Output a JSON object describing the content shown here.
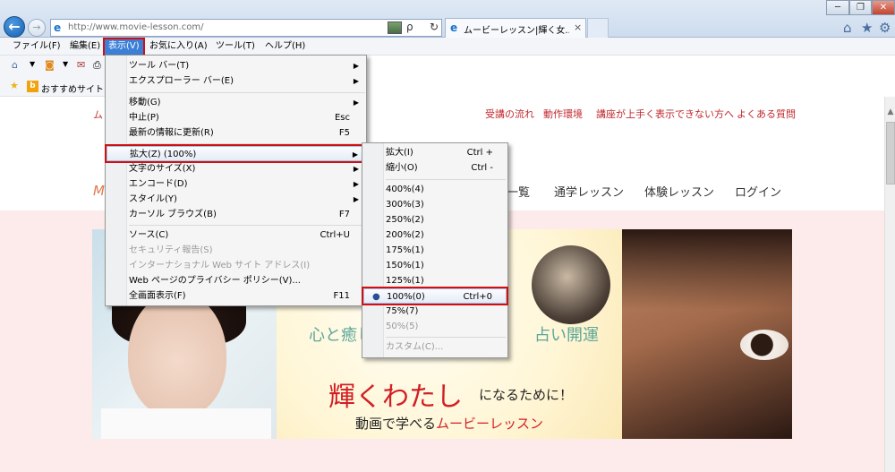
{
  "browser": {
    "url": "http://www.movie-lesson.com/",
    "tab_title": "ムービーレッスン|輝く女...",
    "tab_close": "×",
    "back_icon": "←",
    "forward_icon": "→",
    "search_icon": "ρ",
    "refresh_icon": "↻",
    "window_min": "─",
    "window_max": "❐",
    "window_close": "✕",
    "home_icon": "⌂",
    "favorites_icon": "★",
    "settings_icon": "⚙"
  },
  "menubar": {
    "items": [
      "ファイル(F)",
      "編集(E)",
      "表示(V)",
      "お気に入り(A)",
      "ツール(T)",
      "ヘルプ(H)"
    ],
    "active_index": 2
  },
  "favorites_bar": {
    "bing_label": "b",
    "label": "おすすめサイト"
  },
  "view_menu": {
    "items": [
      {
        "label": "ツール バー(T)",
        "shortcut": "",
        "submenu": true
      },
      {
        "label": "エクスプローラー バー(E)",
        "shortcut": "",
        "submenu": true
      },
      {
        "label": "移動(G)",
        "shortcut": "",
        "submenu": true
      },
      {
        "label": "中止(P)",
        "shortcut": "Esc",
        "submenu": false
      },
      {
        "label": "最新の情報に更新(R)",
        "shortcut": "F5",
        "submenu": false
      },
      {
        "label": "拡大(Z) (100%)",
        "shortcut": "",
        "submenu": true
      },
      {
        "label": "文字のサイズ(X)",
        "shortcut": "",
        "submenu": true
      },
      {
        "label": "エンコード(D)",
        "shortcut": "",
        "submenu": true
      },
      {
        "label": "スタイル(Y)",
        "shortcut": "",
        "submenu": true
      },
      {
        "label": "カーソル ブラウズ(B)",
        "shortcut": "F7",
        "submenu": false
      },
      {
        "label": "ソース(C)",
        "shortcut": "Ctrl+U",
        "submenu": false
      },
      {
        "label": "セキュリティ報告(S)",
        "shortcut": "",
        "submenu": false,
        "disabled": true
      },
      {
        "label": "インターナショナル Web サイト アドレス(I)",
        "shortcut": "",
        "submenu": false,
        "disabled": true
      },
      {
        "label": "Web ページのプライバシー ポリシー(V)...",
        "shortcut": "",
        "submenu": false
      },
      {
        "label": "全画面表示(F)",
        "shortcut": "F11",
        "submenu": false
      }
    ],
    "submenu_arrow": "▶"
  },
  "zoom_menu": {
    "items": [
      {
        "label": "拡大(I)",
        "shortcut": "Ctrl +"
      },
      {
        "label": "縮小(O)",
        "shortcut": "Ctrl -"
      },
      {
        "label": "400%(4)",
        "shortcut": ""
      },
      {
        "label": "300%(3)",
        "shortcut": ""
      },
      {
        "label": "250%(2)",
        "shortcut": ""
      },
      {
        "label": "200%(2)",
        "shortcut": ""
      },
      {
        "label": "175%(1)",
        "shortcut": ""
      },
      {
        "label": "150%(1)",
        "shortcut": ""
      },
      {
        "label": "125%(1)",
        "shortcut": ""
      },
      {
        "label": "100%(0)",
        "shortcut": "Ctrl+0",
        "selected": true
      },
      {
        "label": "75%(7)",
        "shortcut": ""
      },
      {
        "label": "50%(5)",
        "shortcut": "",
        "disabled": true
      },
      {
        "label": "カスタム(C)...",
        "shortcut": "",
        "disabled": true
      }
    ],
    "selected_bullet": "●"
  },
  "page": {
    "logo_top": "ム",
    "logo": "M",
    "top_links": [
      "受講の流れ",
      "動作環境",
      "講座が上手く表示できない方へ",
      "よくある質問"
    ],
    "nav_items": [
      "一覧",
      "通学レッスン",
      "体験レッスン",
      "ログイン"
    ],
    "hero": {
      "text_left": "心と癒し",
      "text_right": "占い開運",
      "title": "輝くわたし",
      "title_suffix": "になるために！",
      "subtitle_prefix": "動画で学べる",
      "subtitle_emphasis": "ムービーレッスン"
    }
  },
  "colors": {
    "menu_highlight_outline": "#d01010",
    "active_menu_bg": "#3c7fd6",
    "link_red": "#c0282d"
  }
}
